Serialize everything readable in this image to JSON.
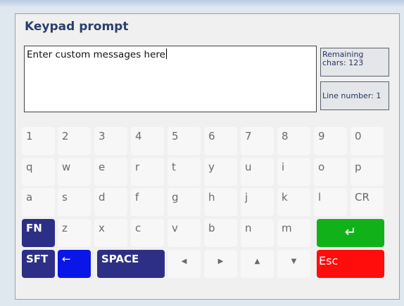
{
  "dialog": {
    "title": "Keypad prompt",
    "message": "Enter custom messages here",
    "remaining_label_line1": "Remaining",
    "remaining_label_line2": "chars: 123",
    "line_number": "Line number: 1"
  },
  "keys": {
    "row1": [
      "1",
      "2",
      "3",
      "4",
      "5",
      "6",
      "7",
      "8",
      "9",
      "0"
    ],
    "row2": [
      "q",
      "w",
      "e",
      "r",
      "t",
      "y",
      "u",
      "i",
      "o",
      "p"
    ],
    "row3": [
      "a",
      "s",
      "d",
      "f",
      "g",
      "h",
      "j",
      "k",
      "l",
      "CR"
    ],
    "row4": [
      "FN",
      "z",
      "x",
      "c",
      "v",
      "b",
      "n",
      "m",
      "↵"
    ],
    "row5": {
      "shift": "SFT",
      "backspace": "←",
      "space": "SPACE",
      "left": "◀",
      "right": "▶",
      "up": "▲",
      "down": "▼",
      "escape": "Esc"
    }
  },
  "colors": {
    "fn_shift_space": "#2d2f86",
    "backspace": "#0a16e8",
    "enter": "#11b219",
    "escape": "#ff0c0c"
  },
  "icons": {
    "enter": "enter-icon",
    "left": "left-arrow-icon",
    "right": "right-arrow-icon",
    "up": "up-arrow-icon",
    "down": "down-arrow-icon",
    "backspace": "backspace-arrow-icon"
  }
}
